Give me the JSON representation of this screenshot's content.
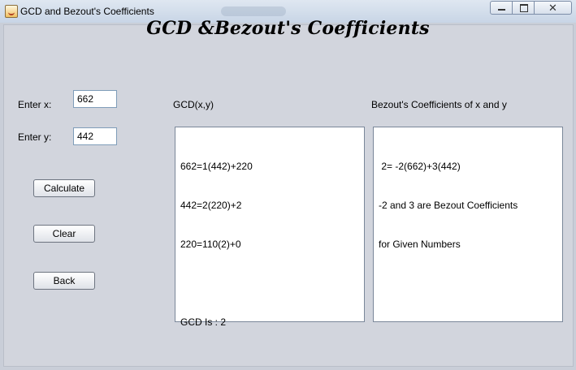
{
  "window": {
    "title": "GCD and Bezout's Coefficients",
    "close_glyph": "✕"
  },
  "heading": "GCD &Bezout's Coefficients",
  "inputs": {
    "x_label": "Enter x:",
    "x_value": "662",
    "y_label": "Enter y:",
    "y_value": "442"
  },
  "buttons": {
    "calculate": "Calculate",
    "clear": "Clear",
    "back": "Back"
  },
  "gcd_panel": {
    "label": "GCD(x,y)",
    "lines": [
      "662=1(442)+220",
      "442=2(220)+2",
      "220=110(2)+0",
      "",
      "GCD Is : 2"
    ]
  },
  "bezout_panel": {
    "label": "Bezout's Coefficients of x and y",
    "lines": [
      " 2= -2(662)+3(442)",
      "-2 and 3 are Bezout Coefficients",
      "for Given Numbers"
    ]
  }
}
